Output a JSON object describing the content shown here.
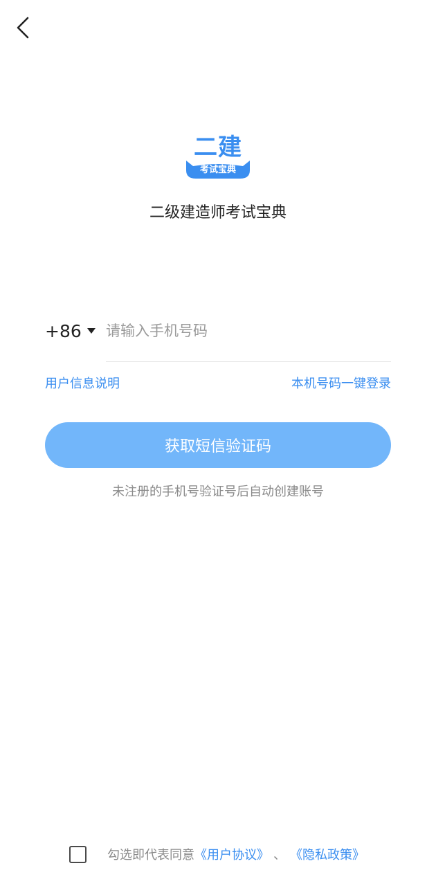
{
  "header": {
    "back_icon": "chevron-left-icon"
  },
  "logo": {
    "main_text": "二建",
    "sub_text": "考试宝典",
    "color": "#3a8ef0"
  },
  "app_name": "二级建造师考试宝典",
  "login_form": {
    "country_code": "+86",
    "phone_placeholder": "请输入手机号码",
    "phone_value": "",
    "user_info_link": "用户信息说明",
    "one_click_login_link": "本机号码一键登录",
    "sms_button_label": "获取短信验证码",
    "hint": "未注册的手机号验证号后自动创建账号"
  },
  "agreement": {
    "checked": false,
    "prefix": "勾选即代表同意",
    "user_agreement": "《用户协议》",
    "separator": "、",
    "privacy_policy": "《隐私政策》"
  },
  "colors": {
    "accent": "#3a8ef0",
    "button_bg": "#72b6fa",
    "muted_text": "#8a8a8a"
  }
}
